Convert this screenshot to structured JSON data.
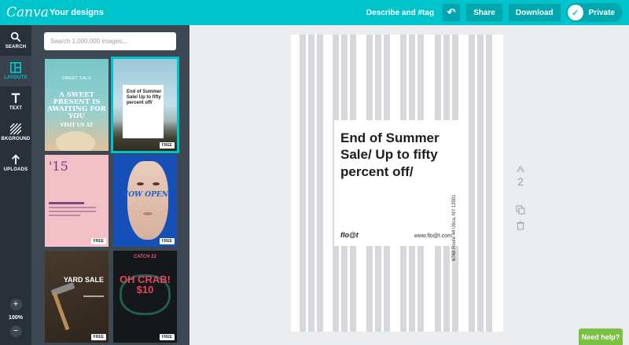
{
  "topbar": {
    "logo": "Canva",
    "your_designs": "Your designs",
    "describe": "Describe and #tag",
    "undo_icon": "undo-icon",
    "share": "Share",
    "download": "Download",
    "privacy": "Private"
  },
  "rail": {
    "items": [
      {
        "label": "SEARCH",
        "icon": "search-icon"
      },
      {
        "label": "LAYOUTS",
        "icon": "layouts-icon"
      },
      {
        "label": "TEXT",
        "icon": "text-icon"
      },
      {
        "label": "BKGROUND",
        "icon": "background-icon"
      },
      {
        "label": "UPLOADS",
        "icon": "upload-icon"
      }
    ],
    "zoom_in": "+",
    "zoom_level": "100%",
    "zoom_out": "−"
  },
  "panel": {
    "search_placeholder": "Search 1,000,000 images...",
    "free_badge": "FREE",
    "t1": {
      "small": "SWEET SALE",
      "headline": "A SWEET PRESENT IS AWAITING FOR YOU",
      "visit": "VISIT US AT"
    },
    "t2": {
      "text": "End of Summer Sale/ Up to fifty percent off/"
    },
    "t3": {
      "num": "'15"
    },
    "t4": {
      "text": "NOW OPEN"
    },
    "t5": {
      "text": "YARD SALE"
    },
    "t6": {
      "catch": "CATCH 22",
      "headline": "OH CRAB! $10"
    }
  },
  "canvas": {
    "headline": "End of Summer Sale/ Up to fifty percent off/",
    "brand": "flo@t",
    "url": "www.flo@t.com",
    "address": "6768 Route 44 Utica, NY 13501",
    "page_number": "2"
  },
  "help": "Need help?"
}
